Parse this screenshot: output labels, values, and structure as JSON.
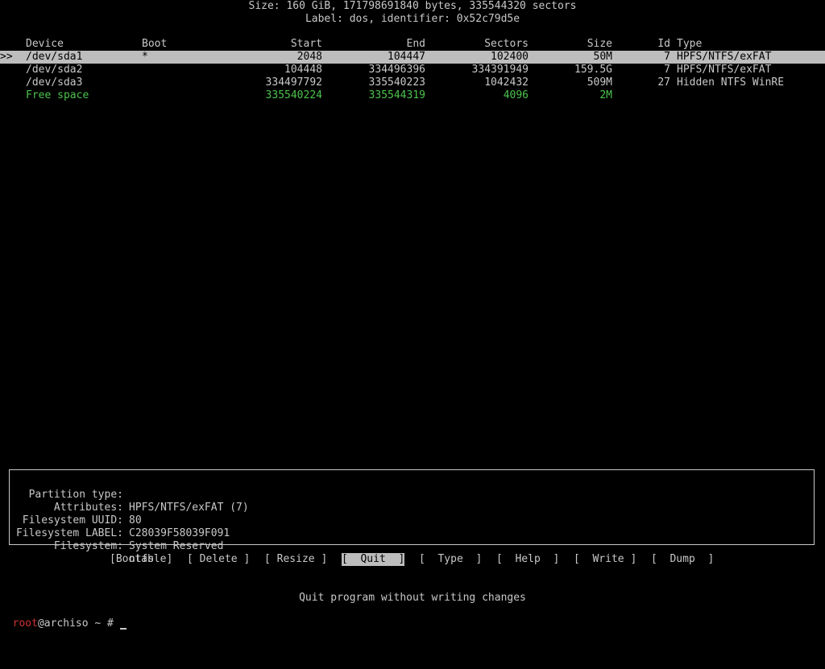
{
  "header": {
    "size_line": "Size: 160 GiB, 171798691840 bytes, 335544320 sectors",
    "label_line": "Label: dos, identifier: 0x52c79d5e"
  },
  "columns": {
    "device": "Device",
    "boot": "Boot",
    "start": "Start",
    "end": "End",
    "sectors": "Sectors",
    "size": "Size",
    "id": "Id",
    "type": "Type"
  },
  "rows": [
    {
      "marker": ">>",
      "device": "/dev/sda1",
      "boot": "*",
      "start": "2048",
      "end": "104447",
      "sectors": "102400",
      "size": "50M",
      "id": "7",
      "type": "HPFS/NTFS/exFAT"
    },
    {
      "marker": "",
      "device": "/dev/sda2",
      "boot": "",
      "start": "104448",
      "end": "334496396",
      "sectors": "334391949",
      "size": "159.5G",
      "id": "7",
      "type": "HPFS/NTFS/exFAT"
    },
    {
      "marker": "",
      "device": "/dev/sda3",
      "boot": "",
      "start": "334497792",
      "end": "335540223",
      "sectors": "1042432",
      "size": "509M",
      "id": "27",
      "type": "Hidden NTFS WinRE"
    },
    {
      "marker": "",
      "device": "Free space",
      "boot": "",
      "start": "335540224",
      "end": "335544319",
      "sectors": "4096",
      "size": "2M",
      "id": "",
      "type": ""
    }
  ],
  "info": {
    "partition_type": {
      "key": "Partition type:",
      "value": "HPFS/NTFS/exFAT (7)"
    },
    "attributes": {
      "key": "Attributes:",
      "value": "80"
    },
    "fs_uuid": {
      "key": "Filesystem UUID:",
      "value": "C28039F58039F091"
    },
    "fs_label": {
      "key": "Filesystem LABEL:",
      "value": "System Reserved"
    },
    "filesystem": {
      "key": "Filesystem:",
      "value": "ntfs"
    }
  },
  "menu": {
    "bootable": "[Bootable]",
    "delete": "[ Delete ]",
    "resize": "[ Resize ]",
    "quit": "[  Quit  ]",
    "type": "[  Type  ]",
    "help": "[  Help  ]",
    "write": "[  Write ]",
    "dump": "[  Dump  ]"
  },
  "status_hint": "Quit program without writing changes",
  "prompt": {
    "user": "root",
    "host_path": "@archiso ~ # "
  },
  "colors": {
    "background": "#000000",
    "text": "#c8c8c8",
    "highlight": "#bdbdbd",
    "free_space": "#4cc34c",
    "prompt_user": "#d23030"
  }
}
